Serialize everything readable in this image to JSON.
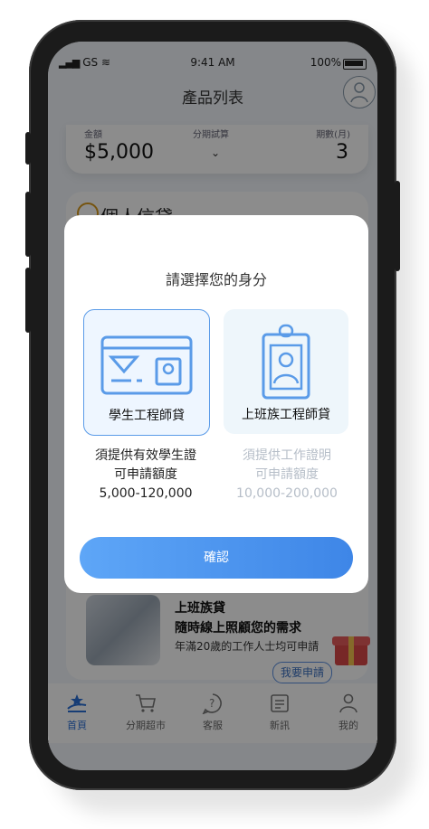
{
  "status": {
    "carrier": "GS",
    "time": "9:41 AM",
    "battery": "100%"
  },
  "nav": {
    "title": "產品列表"
  },
  "calculator": {
    "amount_label": "金額",
    "installment_label": "分期試算",
    "term_label": "期數(月)",
    "amount": "$5,000",
    "term": "3"
  },
  "section": {
    "title": "個人信貸"
  },
  "loan": {
    "title": "上班族貸",
    "subtitle": "隨時線上照顧您的需求",
    "desc": "年滿20歲的工作人士均可申請",
    "apply": "我要申請"
  },
  "tabs": [
    {
      "label": "首頁",
      "icon": "home-icon",
      "active": true
    },
    {
      "label": "分期超市",
      "icon": "cart-icon",
      "active": false
    },
    {
      "label": "客服",
      "icon": "help-icon",
      "active": false
    },
    {
      "label": "新訊",
      "icon": "news-icon",
      "active": false
    },
    {
      "label": "我的",
      "icon": "profile-icon",
      "active": false
    }
  ],
  "modal": {
    "title": "請選擇您的身分",
    "options": [
      {
        "label": "學生工程師貸",
        "requirement": "須提供有效學生證",
        "amount_label": "可申請額度",
        "amount_range": "5,000-120,000",
        "selected": true
      },
      {
        "label": "上班族工程師貸",
        "requirement": "須提供工作證明",
        "amount_label": "可申請額度",
        "amount_range": "10,000-200,000",
        "selected": false
      }
    ],
    "confirm": "確認"
  },
  "colors": {
    "accent": "#3e86e7",
    "accent_light": "#5ea6f7",
    "inactive_text": "#b6bec8"
  }
}
